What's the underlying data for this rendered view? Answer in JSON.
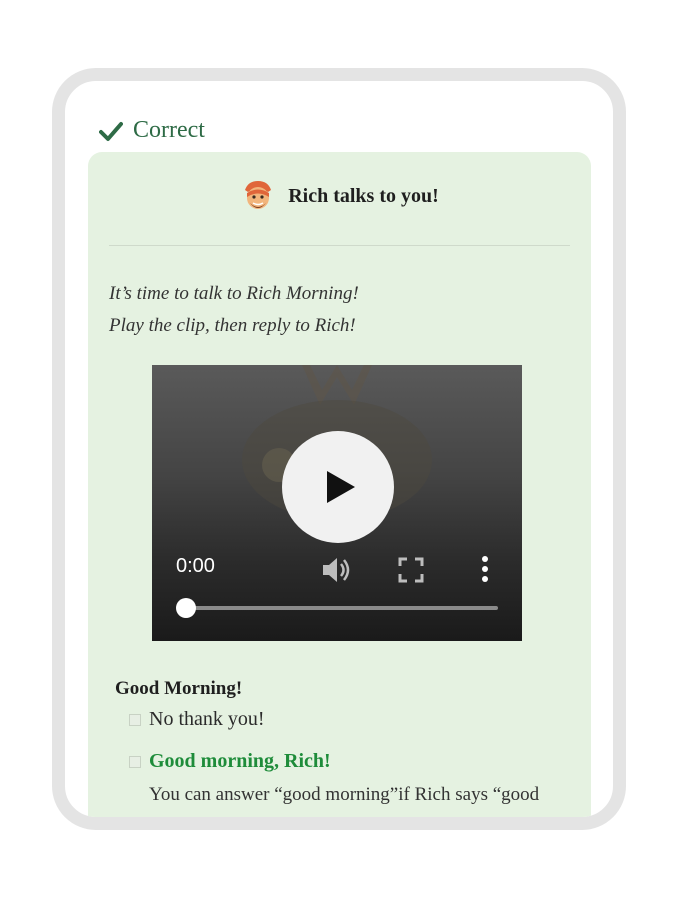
{
  "status": {
    "label": "Correct",
    "icon": "check-icon",
    "color": "#2e6b46"
  },
  "card": {
    "header": {
      "title": "Rich talks to you!",
      "avatar_icon": "rich-avatar-icon"
    },
    "intro": [
      "It’s time to talk to Rich Morning!",
      "Play the clip, then reply to Rich!"
    ],
    "video": {
      "time": "0:00",
      "progress": 0,
      "controls": [
        "play-icon",
        "volume-icon",
        "fullscreen-icon",
        "more-options-icon"
      ]
    },
    "question": "Good Morning!",
    "options": [
      {
        "label": "No thank you!",
        "correct": false
      },
      {
        "label": "Good morning, Rich!",
        "correct": true
      }
    ],
    "explanation": "You can answer “good morning”if Rich says “good"
  },
  "colors": {
    "card_bg": "#e5f2e1",
    "correct_green": "#1e8c3a",
    "frame": "#e4e4e4"
  }
}
